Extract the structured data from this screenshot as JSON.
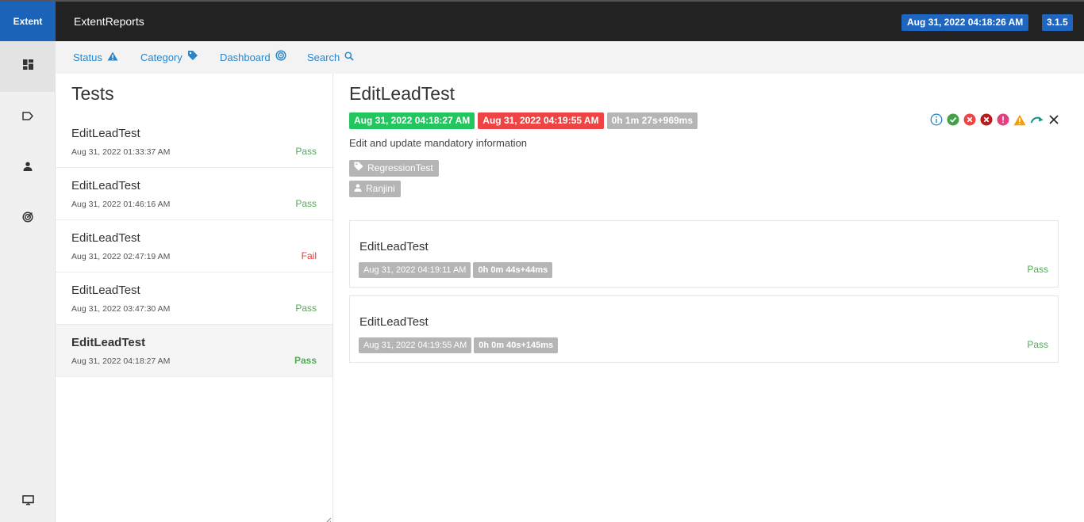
{
  "header": {
    "brand": "Extent",
    "report_name": "ExtentReports",
    "date": "Aug 31, 2022 04:18:26 AM",
    "version": "3.1.5"
  },
  "nav_icons": [
    "dashboard-icon",
    "tag-icon",
    "person-icon",
    "radar-icon",
    "monitor-icon"
  ],
  "subnav": {
    "status": "Status",
    "category": "Category",
    "dashboard": "Dashboard",
    "search": "Search"
  },
  "tests": {
    "title": "Tests",
    "items": [
      {
        "name": "EditLeadTest",
        "time": "Aug 31, 2022 01:33:37 AM",
        "status": "Pass"
      },
      {
        "name": "EditLeadTest",
        "time": "Aug 31, 2022 01:46:16 AM",
        "status": "Pass"
      },
      {
        "name": "EditLeadTest",
        "time": "Aug 31, 2022 02:47:19 AM",
        "status": "Fail"
      },
      {
        "name": "EditLeadTest",
        "time": "Aug 31, 2022 03:47:30 AM",
        "status": "Pass"
      },
      {
        "name": "EditLeadTest",
        "time": "Aug 31, 2022 04:18:27 AM",
        "status": "Pass"
      }
    ]
  },
  "detail": {
    "title": "EditLeadTest",
    "start": "Aug 31, 2022 04:18:27 AM",
    "end": "Aug 31, 2022 04:19:55 AM",
    "duration": "0h 1m 27s+969ms",
    "description": "Edit and update mandatory information",
    "category": "RegressionTest",
    "author": "Ranjini",
    "nodes": [
      {
        "name": "EditLeadTest",
        "time": "Aug 31, 2022 04:19:11 AM",
        "duration": "0h 0m 44s+44ms",
        "status": "Pass"
      },
      {
        "name": "EditLeadTest",
        "time": "Aug 31, 2022 04:19:55 AM",
        "duration": "0h 0m 40s+145ms",
        "status": "Pass"
      }
    ]
  },
  "colors": {
    "brand": "#1a63b8",
    "pass": "#4caf50",
    "fail": "#e53935",
    "link": "#2a86c8"
  }
}
